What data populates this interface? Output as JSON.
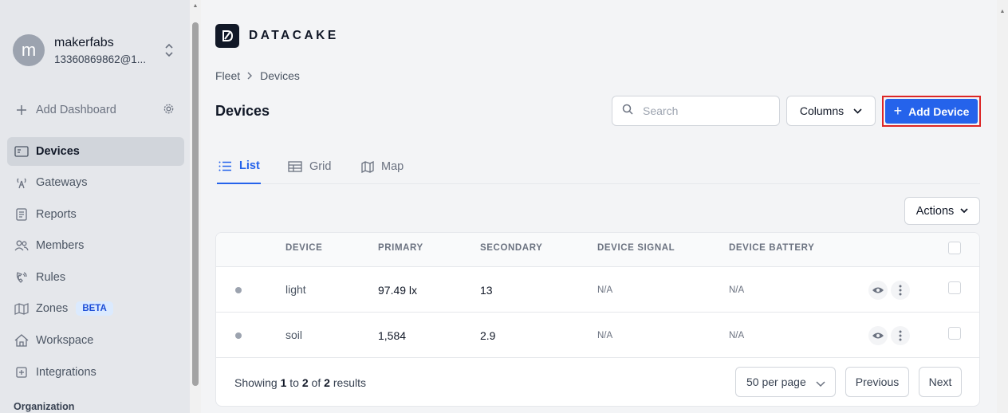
{
  "sidebar": {
    "account": {
      "avatar_letter": "m",
      "name": "makerfabs",
      "email": "13360869862@1..."
    },
    "add_dashboard": "Add Dashboard",
    "items": [
      {
        "label": "Devices",
        "icon": "devices-icon",
        "active": true
      },
      {
        "label": "Gateways",
        "icon": "gateway-icon"
      },
      {
        "label": "Reports",
        "icon": "reports-icon"
      },
      {
        "label": "Members",
        "icon": "members-icon"
      },
      {
        "label": "Rules",
        "icon": "rules-icon"
      },
      {
        "label": "Zones",
        "icon": "map-icon",
        "badge": "BETA"
      },
      {
        "label": "Workspace",
        "icon": "home-icon"
      },
      {
        "label": "Integrations",
        "icon": "integrations-icon"
      }
    ],
    "section_label": "Organization"
  },
  "brand": {
    "name": "DATACAKE"
  },
  "breadcrumb": {
    "items": [
      "Fleet",
      "Devices"
    ]
  },
  "page": {
    "title": "Devices",
    "search_placeholder": "Search",
    "columns_label": "Columns",
    "add_device_label": "Add Device"
  },
  "tabs": [
    {
      "label": "List",
      "icon": "list-icon",
      "active": true
    },
    {
      "label": "Grid",
      "icon": "grid-icon"
    },
    {
      "label": "Map",
      "icon": "map-icon"
    }
  ],
  "actions_label": "Actions",
  "table": {
    "headers": [
      "DEVICE",
      "PRIMARY",
      "SECONDARY",
      "DEVICE SIGNAL",
      "DEVICE BATTERY"
    ],
    "rows": [
      {
        "device": "light",
        "primary": "97.49 lx",
        "secondary": "13",
        "signal": "N/A",
        "battery": "N/A"
      },
      {
        "device": "soil",
        "primary": "1,584",
        "secondary": "2.9",
        "signal": "N/A",
        "battery": "N/A"
      }
    ]
  },
  "pagination": {
    "showing_prefix": "Showing",
    "from": "1",
    "to_word": "to",
    "to": "2",
    "of_word": "of",
    "total": "2",
    "results_word": "results",
    "per_page": "50 per page",
    "previous": "Previous",
    "next": "Next"
  },
  "colors": {
    "accent": "#2563eb",
    "highlight_border": "#dc2626",
    "sidebar_bg": "#e5e7eb"
  }
}
